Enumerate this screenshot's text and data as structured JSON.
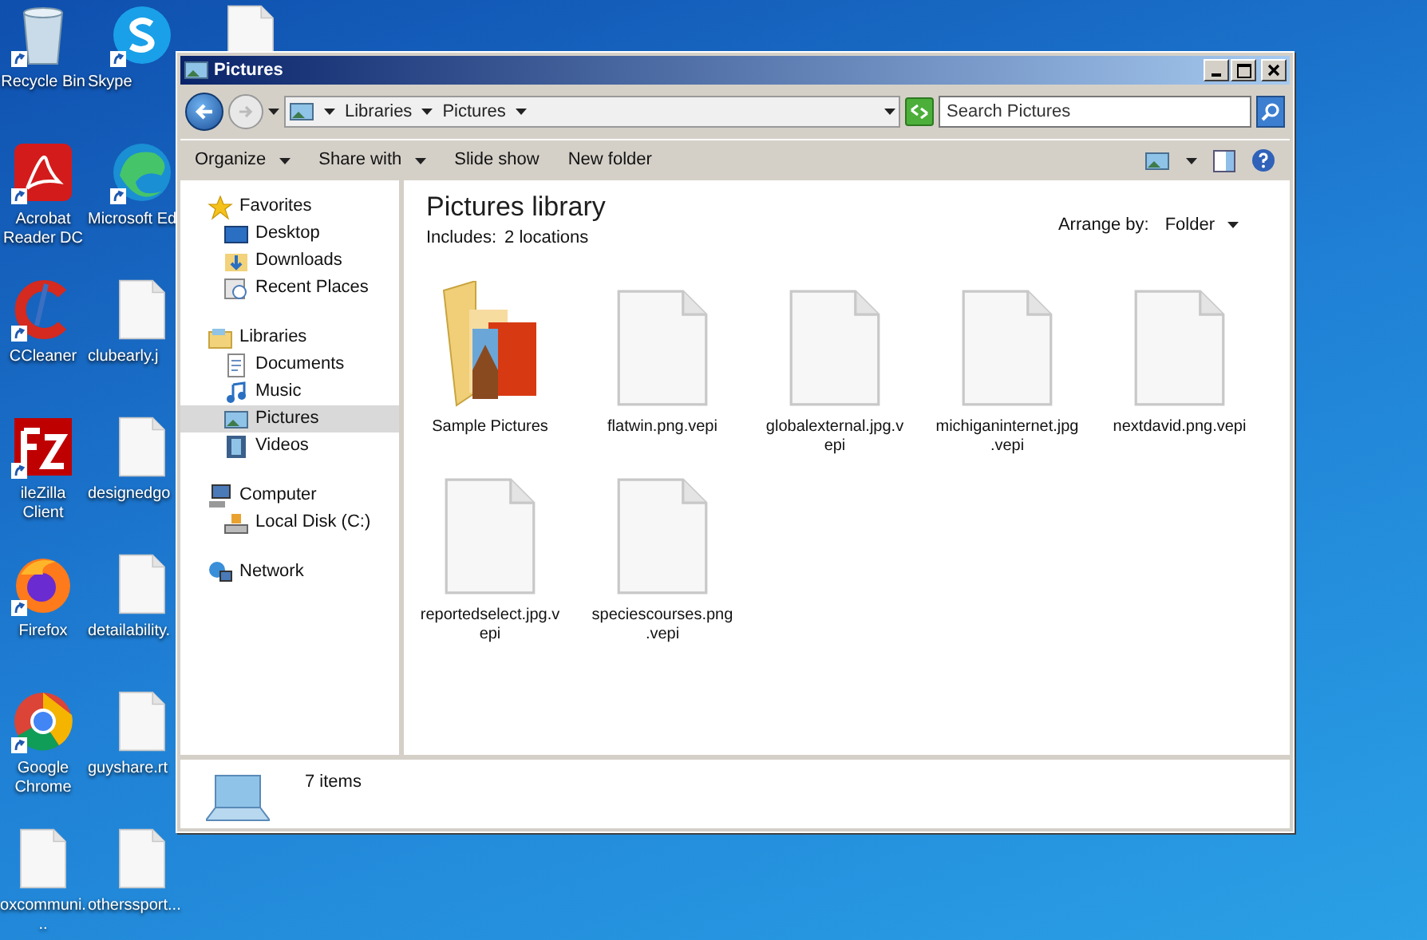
{
  "desktop": {
    "columns": [
      [
        {
          "label": "Recycle Bin",
          "kind": "recycle"
        },
        {
          "label": "Acrobat Reader DC",
          "kind": "acrobat"
        },
        {
          "label": "CCleaner",
          "kind": "ccleaner"
        },
        {
          "label": "ileZilla Client",
          "kind": "filezilla"
        },
        {
          "label": "Firefox",
          "kind": "firefox"
        },
        {
          "label": "Google Chrome",
          "kind": "chrome"
        },
        {
          "label": "oxcommuni...",
          "kind": "file"
        }
      ],
      [
        {
          "label": "Skype",
          "kind": "skype"
        },
        {
          "label": "Microsoft Ed",
          "kind": "edge"
        },
        {
          "label": "clubearly.j",
          "kind": "file"
        },
        {
          "label": "designedgo",
          "kind": "file"
        },
        {
          "label": "detailability.",
          "kind": "file"
        },
        {
          "label": "guyshare.rt",
          "kind": "file"
        },
        {
          "label": "otherssport...",
          "kind": "file"
        }
      ],
      [
        {
          "kind": "file"
        }
      ]
    ]
  },
  "window": {
    "title": "Pictures",
    "address": {
      "breadcrumb": [
        "Libraries",
        "Pictures"
      ]
    },
    "search": {
      "placeholder": "Search Pictures"
    },
    "toolbar": [
      {
        "label": "Organize",
        "dropdown": true
      },
      {
        "label": "Share with",
        "dropdown": true
      },
      {
        "label": "Slide show",
        "dropdown": false
      },
      {
        "label": "New folder",
        "dropdown": false
      }
    ],
    "sidebar": {
      "groups": [
        {
          "label": "Favorites",
          "kind": "star",
          "children": [
            {
              "label": "Desktop",
              "kind": "desktop",
              "selected": false
            },
            {
              "label": "Downloads",
              "kind": "downloads",
              "selected": false
            },
            {
              "label": "Recent Places",
              "kind": "recent",
              "selected": false
            }
          ]
        },
        {
          "label": "Libraries",
          "kind": "libraries",
          "children": [
            {
              "label": "Documents",
              "kind": "documents",
              "selected": false
            },
            {
              "label": "Music",
              "kind": "music",
              "selected": false
            },
            {
              "label": "Pictures",
              "kind": "pictures",
              "selected": true
            },
            {
              "label": "Videos",
              "kind": "videos",
              "selected": false
            }
          ]
        },
        {
          "label": "Computer",
          "kind": "computer",
          "children": [
            {
              "label": "Local Disk (C:)",
              "kind": "disk",
              "selected": false
            }
          ]
        },
        {
          "label": "Network",
          "kind": "network"
        }
      ]
    },
    "content": {
      "title": "Pictures library",
      "includes_label": "Includes:",
      "locations_link": "2 locations",
      "arrange_label": "Arrange by:",
      "arrange_value": "Folder",
      "items": [
        {
          "name": "Sample Pictures",
          "kind": "folder"
        },
        {
          "name": "flatwin.png.vepi",
          "kind": "file"
        },
        {
          "name": "globalexternal.jpg.vepi",
          "kind": "file"
        },
        {
          "name": "michiganinternet.jpg.vepi",
          "kind": "file"
        },
        {
          "name": "nextdavid.png.vepi",
          "kind": "file"
        },
        {
          "name": "reportedselect.jpg.vepi",
          "kind": "file"
        },
        {
          "name": "speciescourses.png.vepi",
          "kind": "file"
        }
      ]
    },
    "status_bar": {
      "count": "7 items"
    }
  }
}
